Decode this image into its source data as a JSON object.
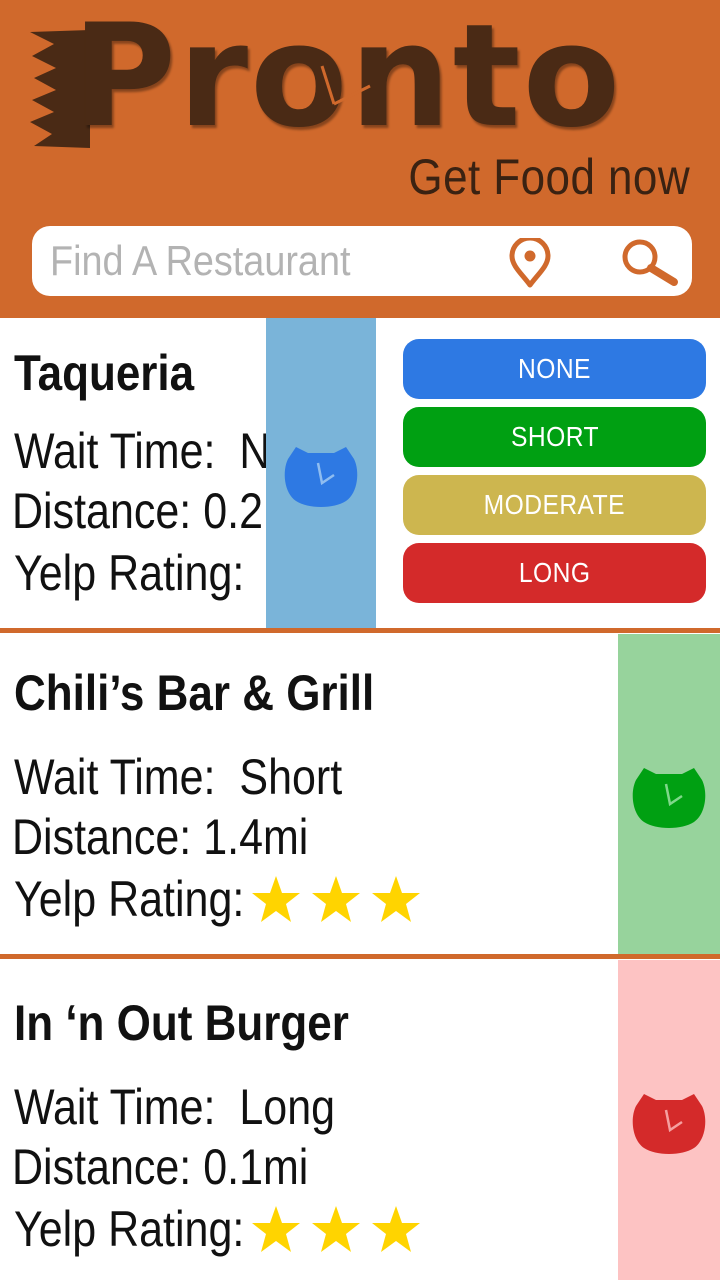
{
  "app": {
    "logo_text": "Pronto",
    "tagline": "Get Food now"
  },
  "search": {
    "placeholder": "Find A Restaurant",
    "value": "",
    "location_icon": "location-pin-icon",
    "search_icon": "magnifier-icon"
  },
  "wait_menu": {
    "options": [
      {
        "label": "NONE",
        "color": "#2e79e3"
      },
      {
        "label": "SHORT",
        "color": "#00a012"
      },
      {
        "label": "MODERATE",
        "color": "#cdb64f"
      },
      {
        "label": "LONG",
        "color": "#d42a2a"
      }
    ]
  },
  "restaurants": [
    {
      "name": "Taqueria",
      "wait_label": "Wait Time:",
      "wait_value": "N",
      "distance_label": "Distance:",
      "distance_value": "0.2",
      "rating_label": "Yelp Rating:",
      "rating_stars": 0,
      "strip_color": "#7ab4d9",
      "clock_color": "#2e79e3"
    },
    {
      "name": "Chili’s Bar & Grill",
      "wait_label": "Wait Time:",
      "wait_value": "Short",
      "distance_label": "Distance:",
      "distance_value": "1.4mi",
      "rating_label": "Yelp Rating:",
      "rating_stars": 3,
      "strip_color": "#97d39c",
      "clock_color": "#00a012"
    },
    {
      "name": "In ‘n Out Burger",
      "wait_label": "Wait Time:",
      "wait_value": "Long",
      "distance_label": "Distance:",
      "distance_value": "0.1mi",
      "rating_label": "Yelp Rating:",
      "rating_stars": 3,
      "strip_color": "#fdc3c3",
      "clock_color": "#d42a2a"
    }
  ],
  "colors": {
    "brand": "#d0692c",
    "logo": "#4a2a15",
    "star": "#ffd400"
  }
}
